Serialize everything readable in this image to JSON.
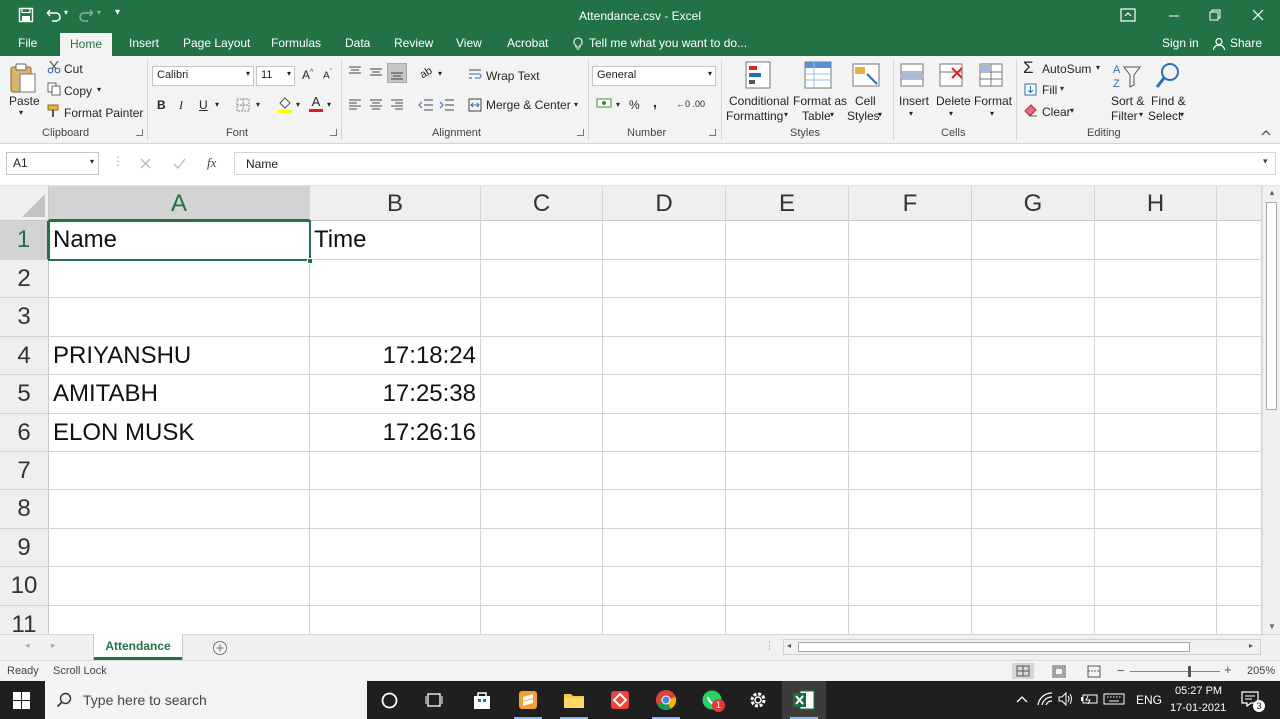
{
  "titlebar": {
    "title": "Attendance.csv - Excel"
  },
  "tabs": {
    "file": "File",
    "home": "Home",
    "insert": "Insert",
    "page_layout": "Page Layout",
    "formulas": "Formulas",
    "data": "Data",
    "review": "Review",
    "view": "View",
    "acrobat": "Acrobat",
    "tell_me": "Tell me what you want to do...",
    "sign_in": "Sign in",
    "share": "Share"
  },
  "ribbon": {
    "clipboard": {
      "paste": "Paste",
      "cut": "Cut",
      "copy": "Copy",
      "format_painter": "Format Painter",
      "label": "Clipboard"
    },
    "font": {
      "name": "Calibri",
      "size": "11",
      "bold": "B",
      "italic": "I",
      "underline": "U",
      "label": "Font"
    },
    "alignment": {
      "wrap_text": "Wrap Text",
      "merge_center": "Merge & Center",
      "label": "Alignment"
    },
    "number": {
      "format": "General",
      "percent": "%",
      "comma": ",",
      "label": "Number"
    },
    "styles": {
      "conditional_1": "Conditional",
      "conditional_2": "Formatting",
      "format_table_1": "Format as",
      "format_table_2": "Table",
      "cell_styles_1": "Cell",
      "cell_styles_2": "Styles",
      "label": "Styles"
    },
    "cells": {
      "insert": "Insert",
      "delete": "Delete",
      "format": "Format",
      "label": "Cells"
    },
    "editing": {
      "autosum": "AutoSum",
      "fill": "Fill",
      "clear": "Clear",
      "sort_1": "Sort &",
      "sort_2": "Filter",
      "find_1": "Find &",
      "find_2": "Select",
      "label": "Editing"
    }
  },
  "formula_bar": {
    "name_box": "A1",
    "fx": "fx",
    "content": "Name"
  },
  "grid": {
    "columns": [
      "A",
      "B",
      "C",
      "D",
      "E",
      "F",
      "G",
      "H"
    ],
    "rows": [
      "1",
      "2",
      "3",
      "4",
      "5",
      "6",
      "7",
      "8",
      "9",
      "10",
      "11"
    ],
    "cells": {
      "A1": "Name",
      "B1": "Time",
      "A4": "PRIYANSHU",
      "B4": "17:18:24",
      "A5": "AMITABH",
      "B5": "17:25:38",
      "A6": "ELON MUSK",
      "B6": "17:26:16"
    },
    "selected_cell": "A1"
  },
  "sheet_tabs": {
    "active": "Attendance"
  },
  "statusbar": {
    "ready": "Ready",
    "scroll_lock": "Scroll Lock",
    "zoom": "205%"
  },
  "taskbar": {
    "search_placeholder": "Type here to search",
    "lang": "ENG",
    "time": "05:27 PM",
    "date": "17-01-2021",
    "notifications": "3",
    "whatsapp_badge": "1"
  },
  "colors": {
    "excel_green": "#217346",
    "taskbar": "#1f1f1f"
  }
}
